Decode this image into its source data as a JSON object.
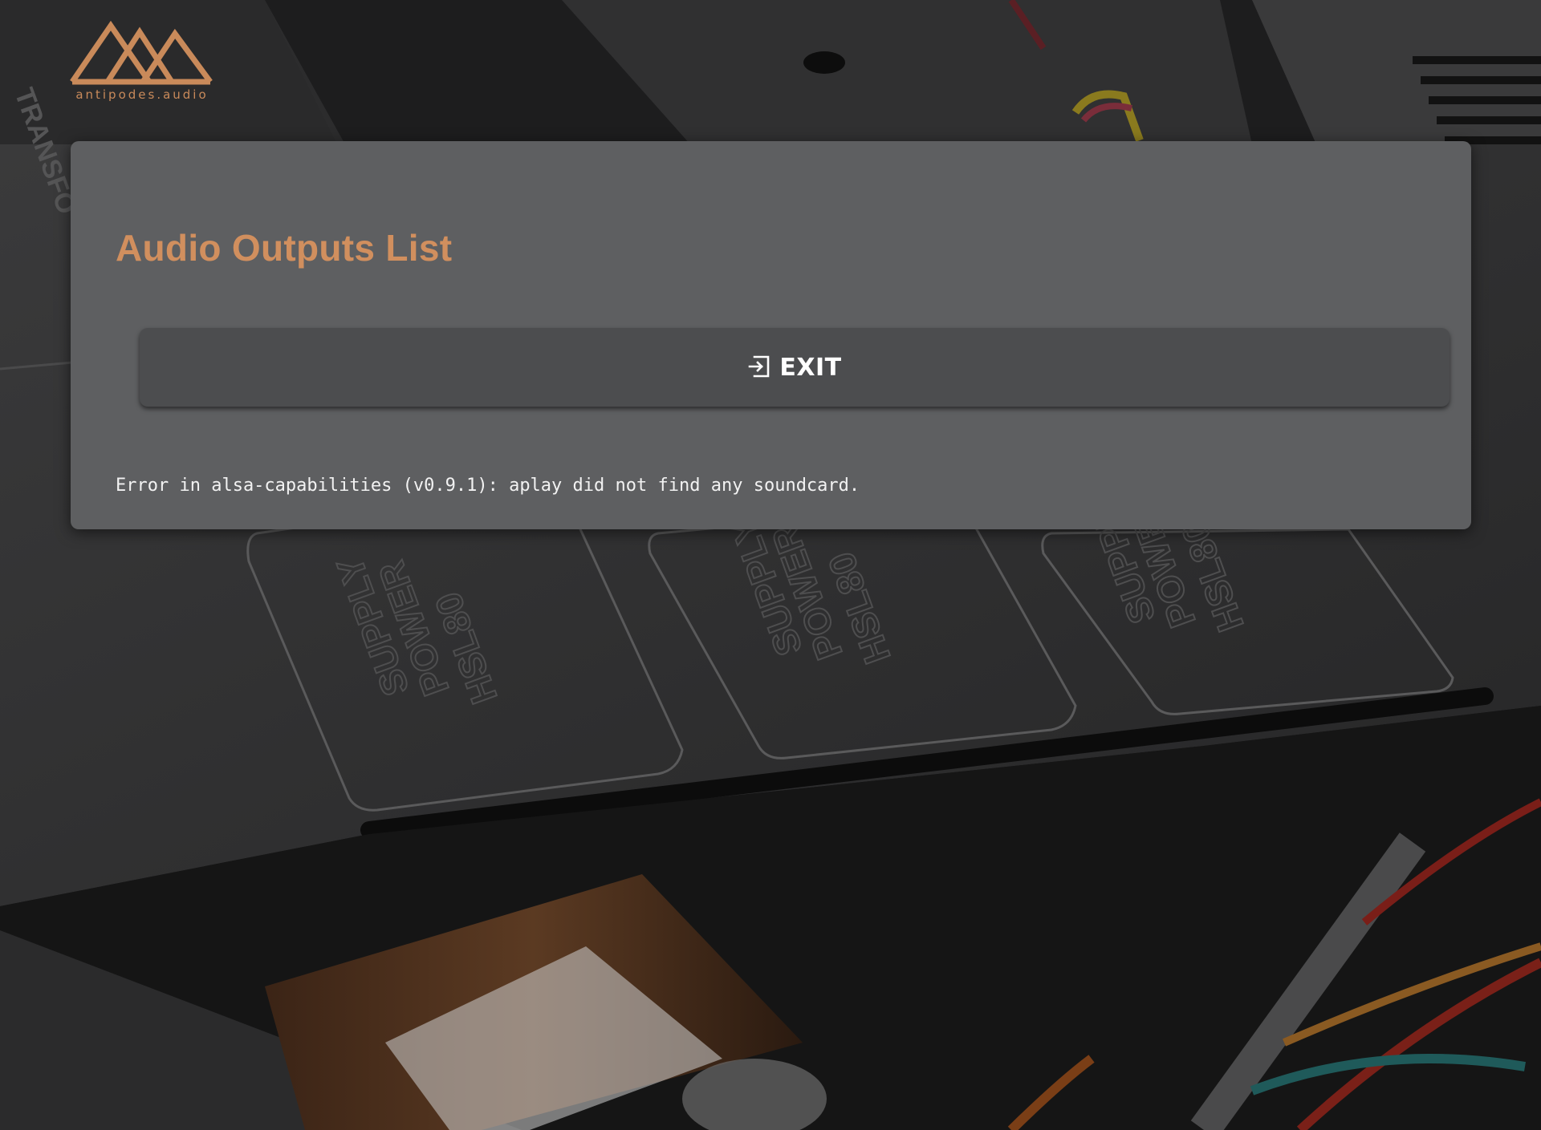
{
  "brand": {
    "logo_text": "antipodes.audio",
    "accent_color": "#d18f5e"
  },
  "background": {
    "labels": [
      "HSL80 POWER SUPPLY",
      "HSL80 POWER SUPPLY",
      "HSL80 POWER SUPPLY",
      "TRANSFO"
    ]
  },
  "panel": {
    "title": "Audio Outputs List",
    "exit_button": {
      "label": "EXIT",
      "icon": "exit-icon"
    },
    "error_message": "Error in alsa-capabilities (v0.9.1): aplay did not find any soundcard."
  }
}
